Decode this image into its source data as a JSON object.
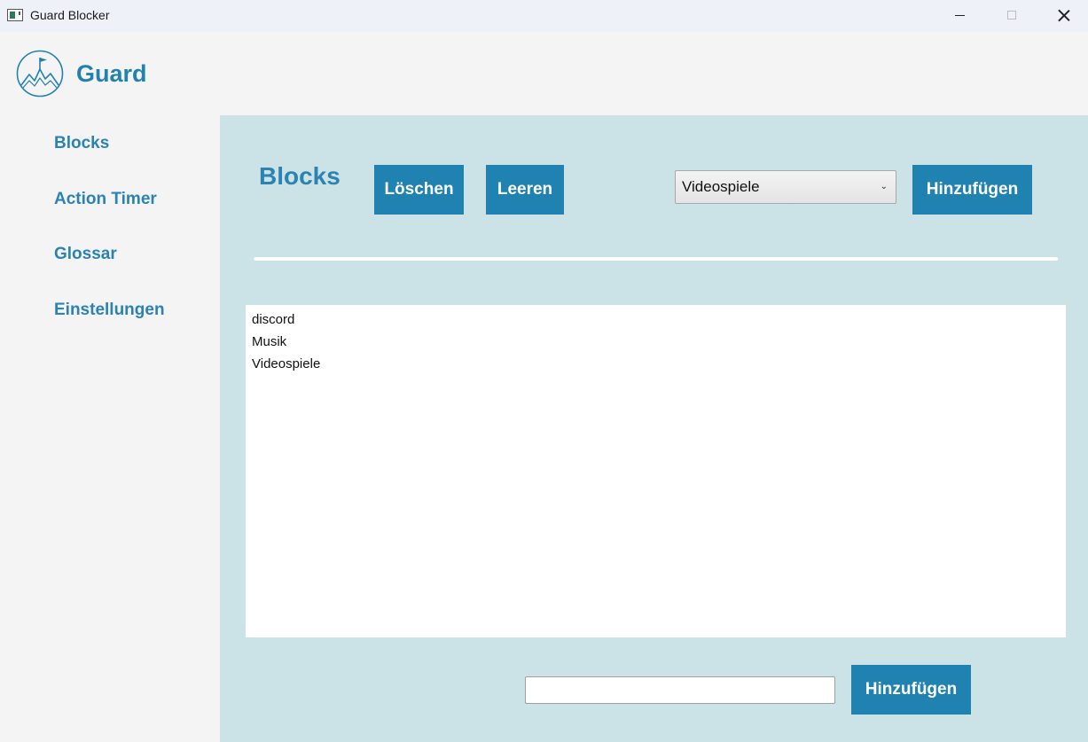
{
  "window": {
    "title": "Guard Blocker"
  },
  "header": {
    "brand": "Guard",
    "logo_icon": "mountain-flag-icon"
  },
  "sidebar": {
    "items": [
      {
        "label": "Blocks"
      },
      {
        "label": "Action Timer"
      },
      {
        "label": "Glossar"
      },
      {
        "label": "Einstellungen"
      }
    ]
  },
  "main": {
    "title": "Blocks",
    "delete_label": "Löschen",
    "clear_label": "Leeren",
    "category_select": {
      "selected": "Videospiele"
    },
    "add_top_label": "Hinzufügen",
    "list_items": [
      "discord",
      "Musik",
      "Videospiele"
    ],
    "new_entry": {
      "value": "",
      "placeholder": ""
    },
    "add_bottom_label": "Hinzufügen"
  },
  "colors": {
    "accent": "#1f82b1",
    "panel": "#cbe2e6",
    "sidebar": "#f4f4f4"
  }
}
